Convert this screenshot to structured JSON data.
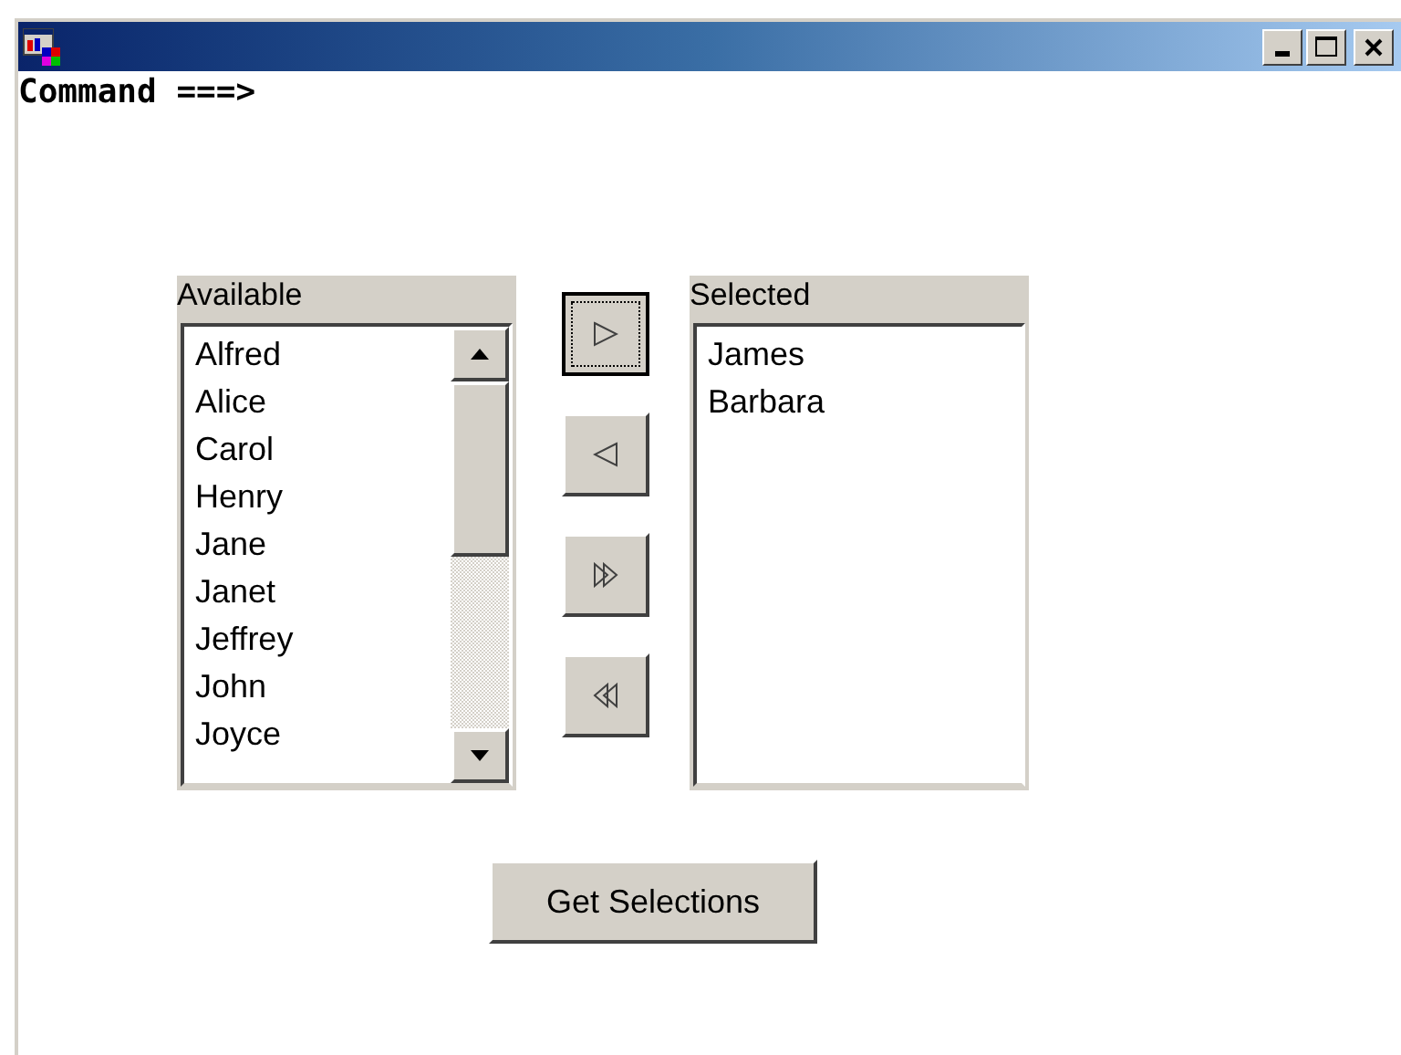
{
  "command_prompt": "Command  ===>",
  "available": {
    "label": "Available",
    "items": [
      {
        "text": "Alfred",
        "selected": false
      },
      {
        "text": "Alice",
        "selected": false
      },
      {
        "text": "Carol",
        "selected": false
      },
      {
        "text": "Henry",
        "selected": false
      },
      {
        "text": "Jane",
        "selected": false
      },
      {
        "text": "Janet",
        "selected": false
      },
      {
        "text": "Jeffrey",
        "selected": false
      },
      {
        "text": "John",
        "selected": false
      },
      {
        "text": "Joyce",
        "selected": false
      }
    ]
  },
  "move_buttons": [
    {
      "kind": "add",
      "focused": true
    },
    {
      "kind": "remove",
      "focused": false
    },
    {
      "kind": "add-all",
      "focused": false
    },
    {
      "kind": "remove-all",
      "focused": false
    }
  ],
  "selected": {
    "label": "Selected",
    "items": [
      {
        "text": "James",
        "selected": false
      },
      {
        "text": "Barbara",
        "selected": false
      }
    ]
  },
  "get_button": {
    "label": "Get Selections"
  }
}
